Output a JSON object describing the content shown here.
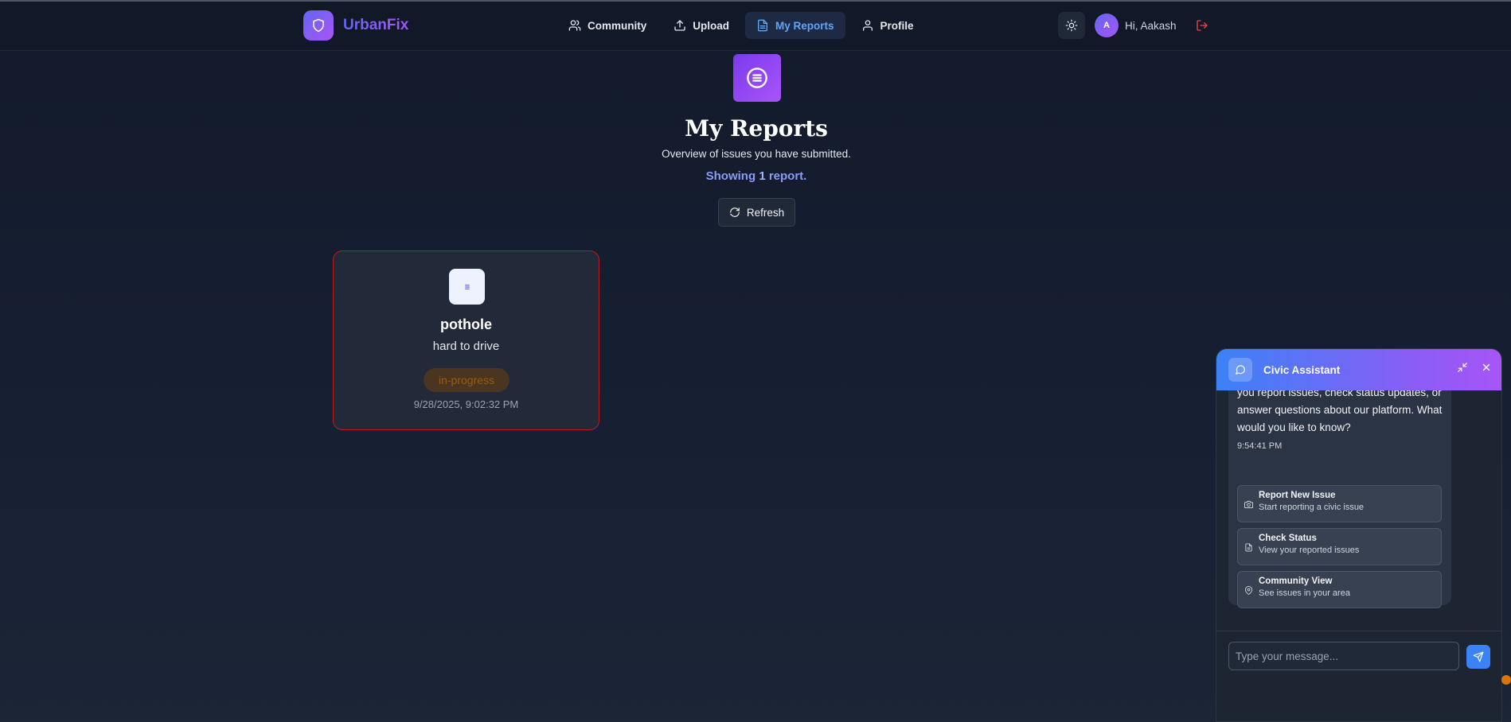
{
  "header": {
    "brand": "UrbanFix",
    "nav": [
      {
        "label": "Community",
        "icon": "users-icon"
      },
      {
        "label": "Upload",
        "icon": "upload-icon"
      },
      {
        "label": "My Reports",
        "icon": "file-icon",
        "active": true
      },
      {
        "label": "Profile",
        "icon": "user-icon"
      }
    ],
    "avatar_initial": "A",
    "greeting": "Hi, Aakash"
  },
  "main": {
    "title": "My Reports",
    "subtitle": "Overview of issues you have submitted.",
    "showing_prefix": "Showing",
    "showing_count": "1",
    "showing_suffix": "report.",
    "refresh_label": "Refresh"
  },
  "reports": [
    {
      "title": "pothole",
      "description": "hard to drive",
      "status": "in-progress",
      "date": "9/28/2025, 9:02:32 PM"
    }
  ],
  "chat": {
    "title": "Civic Assistant",
    "message": "you report issues, check status updates, or answer questions about our platform. What would you like to know?",
    "time": "9:54:41 PM",
    "actions": [
      {
        "title": "Report New Issue",
        "subtitle": "Start reporting a civic issue",
        "icon": "camera-icon"
      },
      {
        "title": "Check Status",
        "subtitle": "View your reported issues",
        "icon": "file-icon"
      },
      {
        "title": "Community View",
        "subtitle": "See issues in your area",
        "icon": "map-pin-icon"
      }
    ],
    "input_placeholder": "Type your message..."
  },
  "colors": {
    "accent": "#60a5fa",
    "brand_start": "#6366f1",
    "brand_end": "#a855f7",
    "card_border": "#b91c1c",
    "logout": "#ef4444"
  }
}
